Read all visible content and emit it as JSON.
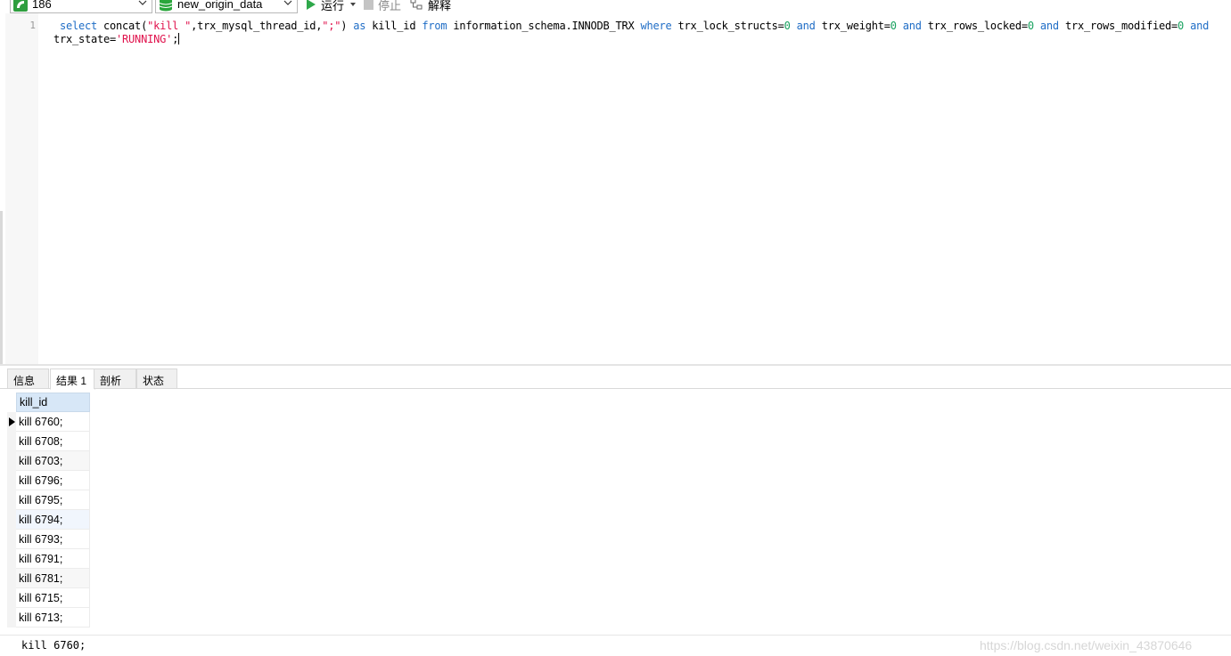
{
  "toolbar": {
    "connection": {
      "label": "186",
      "icon": "connection-icon"
    },
    "database": {
      "label": "new_origin_data",
      "icon": "database-icon"
    },
    "run_label": "运行",
    "stop_label": "停止",
    "explain_label": "解释"
  },
  "editor": {
    "line_number": "1",
    "line1": {
      "select": "select",
      "concat_open": " concat(",
      "kill_str": "\"kill \"",
      "thread_col": ",trx_mysql_thread_id,",
      "semi_str": "\";\"",
      "concat_close": ") ",
      "as": "as",
      "alias": " kill_id ",
      "from": "from",
      "table": " information_schema.INNODB_TRX ",
      "where": "where",
      "cond1": " trx_lock_structs=",
      "v1": "0",
      "and1": "and",
      "cond2": " trx_weight=",
      "v2": "0",
      "and2": "and",
      "cond3": " trx_rows_locked=",
      "v3": "0",
      "and3": "and",
      "cond4": " trx_rows_modified=",
      "v4": "0",
      "and4": "and"
    },
    "line2": {
      "col": "trx_state=",
      "value": "'RUNNING'",
      "end": ";"
    },
    "colors": {
      "keyword": "#1f6dc6",
      "string": "#e0134d",
      "number": "#1aa260"
    }
  },
  "tabs": [
    {
      "label": "信息"
    },
    {
      "label": "结果 1"
    },
    {
      "label": "剖析"
    },
    {
      "label": "状态"
    }
  ],
  "results": {
    "column": "kill_id",
    "rows": [
      "kill 6760;",
      "kill 6708;",
      "kill 6703;",
      "kill 6796;",
      "kill 6795;",
      "kill 6794;",
      "kill 6793;",
      "kill 6791;",
      "kill 6781;",
      "kill 6715;",
      "kill 6713;"
    ]
  },
  "status": {
    "text": "kill 6760;",
    "watermark": "https://blog.csdn.net/weixin_43870646"
  }
}
